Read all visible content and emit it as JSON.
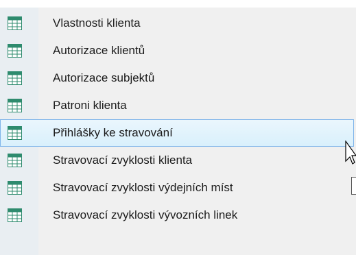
{
  "menu": {
    "items": [
      {
        "label": "Vlastnosti klienta",
        "icon": "table-icon"
      },
      {
        "label": "Autorizace klientů",
        "icon": "table-icon"
      },
      {
        "label": "Autorizace subjektů",
        "icon": "table-icon"
      },
      {
        "label": "Patroni klienta",
        "icon": "table-icon"
      },
      {
        "label": "Přihlášky ke stravování",
        "icon": "table-icon"
      },
      {
        "label": "Stravovací zvyklosti klienta",
        "icon": "table-icon"
      },
      {
        "label": "Stravovací zvyklosti výdejních míst",
        "icon": "table-icon"
      },
      {
        "label": "Stravovací zvyklosti vývozních linek",
        "icon": "table-icon"
      }
    ],
    "selected_index": 4
  },
  "colors": {
    "icon_border": "#2e8b6e",
    "icon_header": "#2e8b6e",
    "highlight_border": "#7eb4ea"
  }
}
